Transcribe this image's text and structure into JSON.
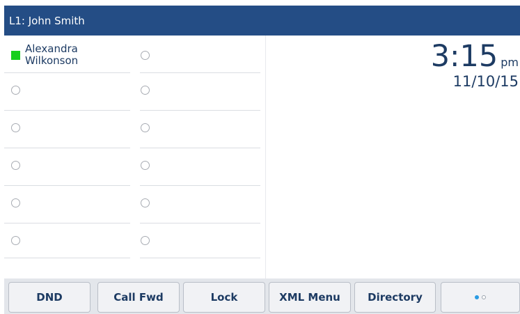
{
  "header": {
    "line_label": "L1: John Smith"
  },
  "programmable_keys": {
    "left": [
      {
        "label": "Alexandra\nWilkonson",
        "status": "available"
      },
      {
        "label": "",
        "status": "idle"
      },
      {
        "label": "",
        "status": "idle"
      },
      {
        "label": "",
        "status": "idle"
      },
      {
        "label": "",
        "status": "idle"
      },
      {
        "label": "",
        "status": "idle"
      }
    ],
    "right": [
      {
        "label": "",
        "status": "idle"
      },
      {
        "label": "",
        "status": "idle"
      },
      {
        "label": "",
        "status": "idle"
      },
      {
        "label": "",
        "status": "idle"
      },
      {
        "label": "",
        "status": "idle"
      },
      {
        "label": "",
        "status": "idle"
      }
    ]
  },
  "clock": {
    "time": "3:15",
    "ampm": "pm",
    "date": "11/10/15"
  },
  "softkeys": [
    {
      "label": "DND"
    },
    {
      "label": "Call Fwd"
    },
    {
      "label": "Lock"
    },
    {
      "label": "XML Menu"
    },
    {
      "label": "Directory"
    },
    {
      "label": "",
      "page_indicator": {
        "pages": 2,
        "current": 1
      }
    }
  ],
  "colors": {
    "header_bg": "#244d85",
    "text": "#1d3b63",
    "presence_available": "#18cf1d",
    "page_dot_active": "#2a9be3"
  }
}
